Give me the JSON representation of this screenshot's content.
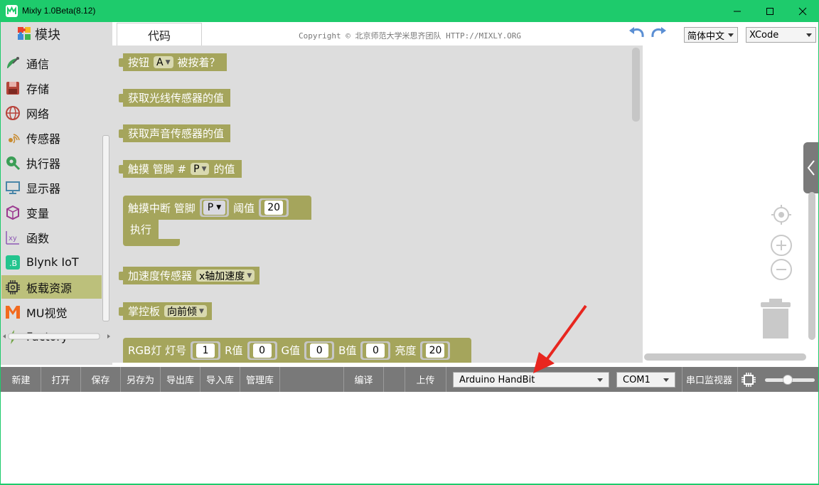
{
  "window": {
    "title": "Mixly 1.0Beta(8.12)"
  },
  "sidebar": {
    "header": "模块",
    "items": [
      {
        "label": "通信",
        "icon": "satellite-dish-icon"
      },
      {
        "label": "存储",
        "icon": "floppy-disk-icon"
      },
      {
        "label": "网络",
        "icon": "globe-icon"
      },
      {
        "label": "传感器",
        "icon": "sensor-waves-icon"
      },
      {
        "label": "执行器",
        "icon": "actuator-icon"
      },
      {
        "label": "显示器",
        "icon": "monitor-icon"
      },
      {
        "label": "变量",
        "icon": "cube-icon"
      },
      {
        "label": "函数",
        "icon": "function-xy-icon"
      },
      {
        "label": "Blynk IoT",
        "icon": "blynk-icon"
      },
      {
        "label": "板载资源",
        "icon": "chip-gear-icon",
        "active": true
      },
      {
        "label": "MU视觉",
        "icon": "mu-logo-icon"
      },
      {
        "label": "Factory",
        "icon": "lightning-icon"
      }
    ]
  },
  "codebar": {
    "tab": "代码",
    "copyright": "Copyright © 北京师范大学米思齐团队 HTTP://MIXLY.ORG",
    "language": "简体中文",
    "theme": "XCode"
  },
  "blocks": {
    "b1": {
      "pre": "按钮",
      "field": "A",
      "post": "被按着？"
    },
    "b2": {
      "text": "获取光线传感器的值"
    },
    "b3": {
      "text": "获取声音传感器的值"
    },
    "b4": {
      "pre": "触摸 管脚 #",
      "field": "P",
      "post": "的值"
    },
    "b5": {
      "pre": "触摸中断 管脚",
      "pin": "P",
      "mid": "阈值",
      "value": "20",
      "exec": "执行"
    },
    "b6": {
      "pre": "加速度传感器",
      "field": "x轴加速度"
    },
    "b7": {
      "pre": "掌控板",
      "field": "向前倾"
    },
    "b8": {
      "pre": "RGB灯  灯号",
      "n": "1",
      "r_label": "R值",
      "r": "0",
      "g_label": "G值",
      "g": "0",
      "b_label": "B值",
      "b": "0",
      "bright_label": "亮度",
      "bright": "20"
    }
  },
  "toolbar": {
    "new": "新建",
    "open": "打开",
    "save": "保存",
    "save_as": "另存为",
    "export_lib": "导出库",
    "import_lib": "导入库",
    "manage_lib": "管理库",
    "compile": "编译",
    "upload": "上传",
    "board": "Arduino HandBit",
    "port": "COM1",
    "serial_monitor": "串口监视器",
    "slider_level": 0.45
  },
  "colors": {
    "titlebar": "#1ecb6c",
    "block": "#a5a55c",
    "toolbar": "#797979",
    "annotation_arrow": "#e8261f"
  }
}
